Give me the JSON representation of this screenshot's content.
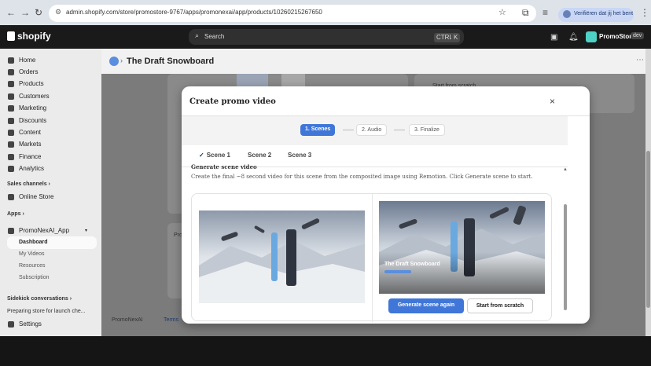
{
  "browser": {
    "url": "admin.shopify.com/store/promostore-9767/apps/promonexai/app/products/10260215267650",
    "verify_text": "Verifiëren dat jij het bent"
  },
  "shopify": {
    "logo": "shopify",
    "search_placeholder": "Search",
    "search_shortcut_1": "CTRL",
    "search_shortcut_2": "K",
    "store_name": "PromoStore",
    "store_badge": "dev"
  },
  "sidebar": {
    "items": [
      {
        "label": "Home",
        "icon": "home-icon"
      },
      {
        "label": "Orders",
        "icon": "orders-icon"
      },
      {
        "label": "Products",
        "icon": "tag-icon"
      },
      {
        "label": "Customers",
        "icon": "person-icon"
      },
      {
        "label": "Marketing",
        "icon": "target-icon"
      },
      {
        "label": "Discounts",
        "icon": "discount-icon"
      },
      {
        "label": "Content",
        "icon": "content-icon"
      },
      {
        "label": "Markets",
        "icon": "globe-icon"
      },
      {
        "label": "Finance",
        "icon": "bank-icon"
      },
      {
        "label": "Analytics",
        "icon": "chart-icon"
      }
    ],
    "sales_channels_label": "Sales channels",
    "online_store": "Online Store",
    "apps_label": "Apps",
    "app_name": "PromoNexAI_App",
    "app_sub": [
      "Dashboard",
      "My Videos",
      "Resources",
      "Subscription"
    ],
    "sidekick_label": "Sidekick conversations",
    "sidekick_item": "Preparing store for launch che...",
    "settings": "Settings"
  },
  "page": {
    "title": "The Draft Snowboard",
    "bg_start_scratch": "Start from scratch",
    "footer_left": "PromoNexAI",
    "footer_terms": "Terms",
    "side_label": "Pro"
  },
  "modal": {
    "title": "Create promo video",
    "steps": [
      "1. Scenes",
      "2. Audio",
      "3. Finalize"
    ],
    "tabs": [
      "Scene 1",
      "Scene 2",
      "Scene 3"
    ],
    "section_title": "Generate scene video",
    "section_desc": "Create the final ~8 second video for this scene from the composited image using Remotion. Click Generate scene to start.",
    "preview_caption": "The Draft Snowboard",
    "generate_button": "Generate scene again",
    "scratch_button": "Start from scratch"
  },
  "colors": {
    "primary": "#3f76d8",
    "sidebar_bg": "#ebebeb",
    "topbar_bg": "#1a1a1a"
  }
}
